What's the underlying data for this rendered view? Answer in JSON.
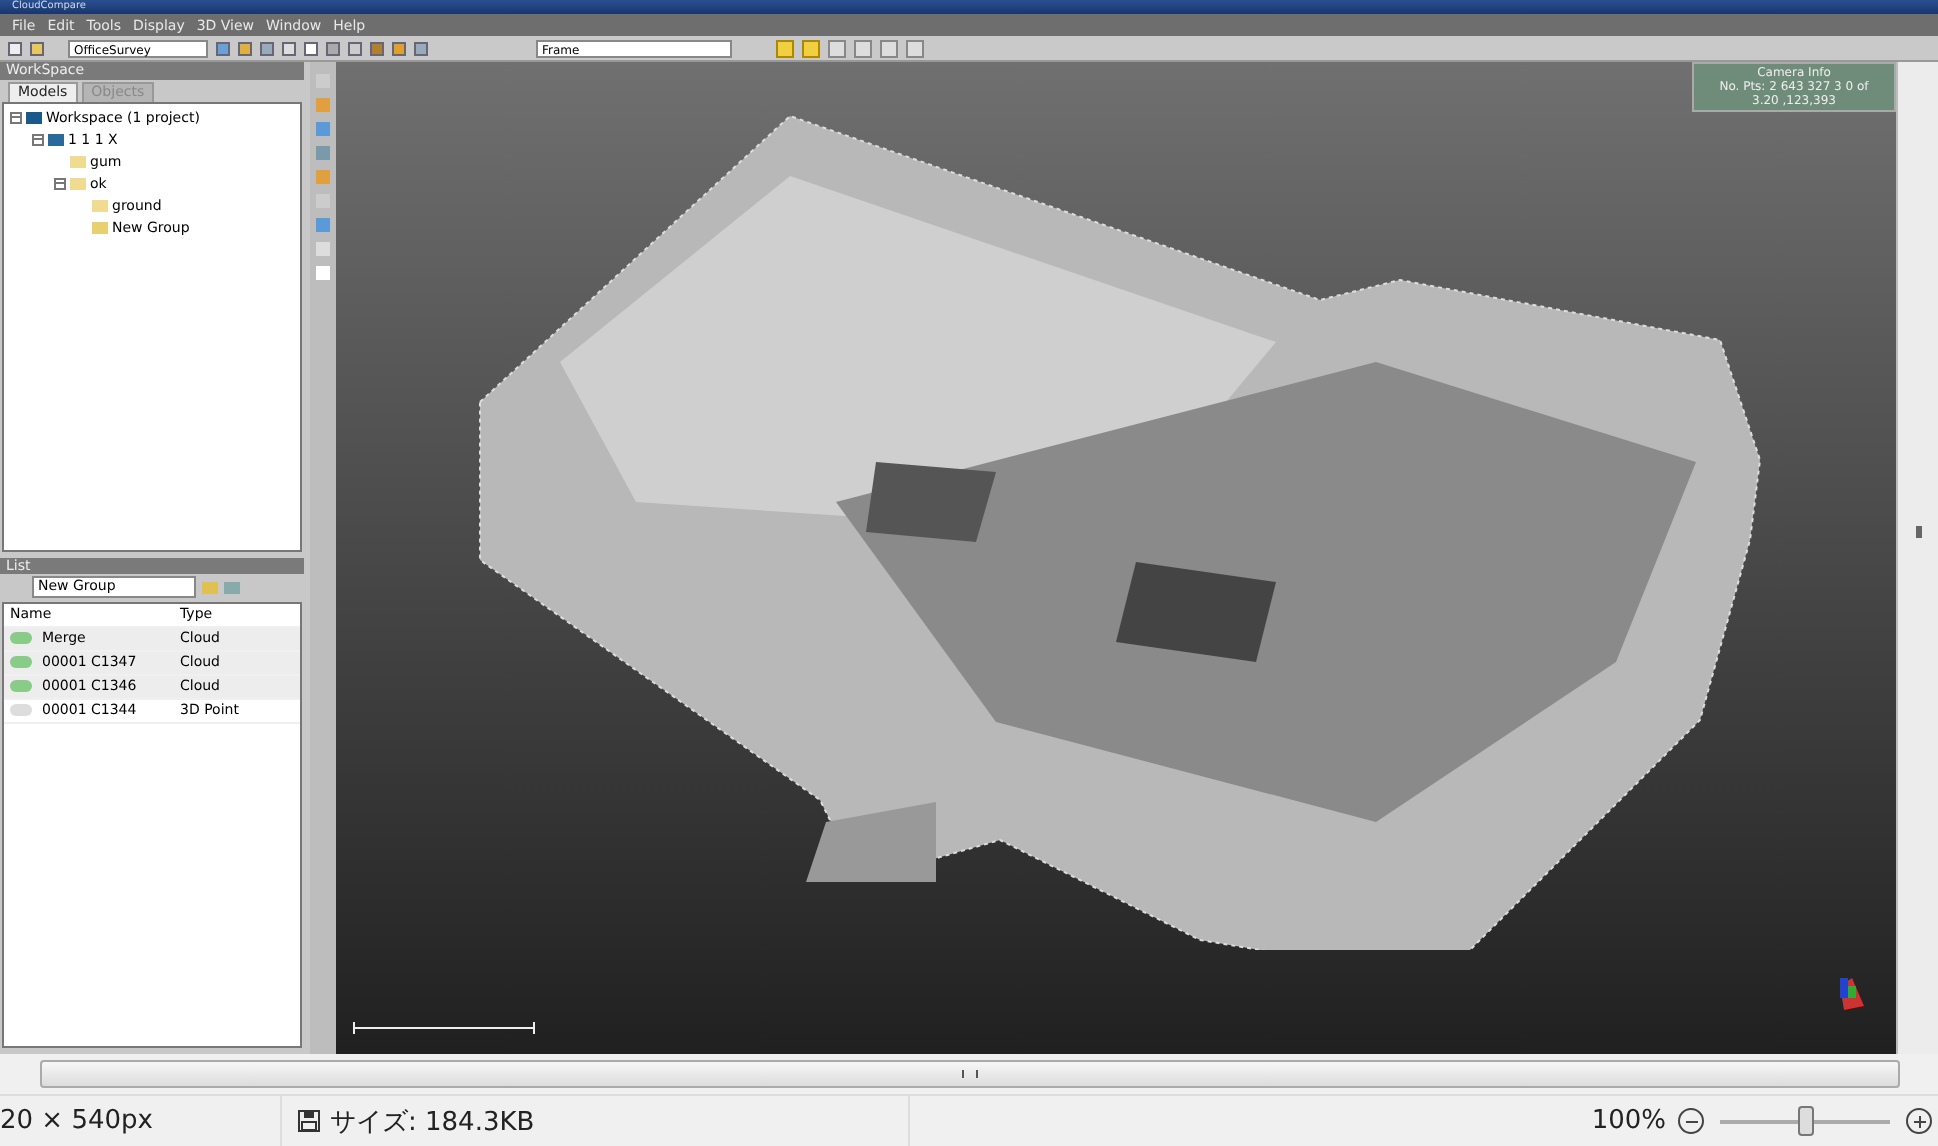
{
  "window": {
    "title": "CloudCompare"
  },
  "menu": [
    "File",
    "Edit",
    "Tools",
    "Display",
    "3D View",
    "Window",
    "Help"
  ],
  "toolbar": {
    "project_combo": "OfficeSurvey",
    "view_combo": "Frame",
    "toggles": [
      {
        "on": true
      },
      {
        "on": true
      },
      {
        "on": false
      },
      {
        "on": false
      },
      {
        "on": false
      },
      {
        "on": false
      }
    ]
  },
  "workspace": {
    "title": "WorkSpace",
    "tabs": [
      {
        "label": "Models",
        "selected": true
      },
      {
        "label": "Objects",
        "selected": false
      }
    ],
    "tree": [
      {
        "label": "Workspace (1 project)",
        "kind": "workspace",
        "expanded": true,
        "children": [
          {
            "label": "1 1 1 X",
            "kind": "project",
            "expanded": true,
            "children": [
              {
                "label": "gum",
                "kind": "folder"
              },
              {
                "label": "ok",
                "kind": "folder",
                "expanded": true,
                "children": [
                  {
                    "label": "ground",
                    "kind": "folder"
                  },
                  {
                    "label": "New Group",
                    "kind": "group"
                  }
                ]
              }
            ]
          }
        ]
      }
    ]
  },
  "list": {
    "title": "List",
    "group_combo": "New Group",
    "columns": [
      "Name",
      "Type"
    ],
    "rows": [
      {
        "name": "Merge",
        "type": "Cloud",
        "kind": "cloud"
      },
      {
        "name": "00001 C1347",
        "type": "Cloud",
        "kind": "cloud"
      },
      {
        "name": "00001 C1346",
        "type": "Cloud",
        "kind": "cloud"
      },
      {
        "name": "00001 C1344",
        "type": "3D Point",
        "kind": "point"
      }
    ]
  },
  "viewport": {
    "info": [
      "Camera Info",
      "No. Pts: 2 643 327 3 0 of",
      "3.20 ,123,393"
    ]
  },
  "status_bar": {
    "dimensions": "20 × 540px",
    "size": "サイズ: 184.3KB",
    "zoom": "100%",
    "zoom_level": {
      "level": 0.5
    }
  }
}
